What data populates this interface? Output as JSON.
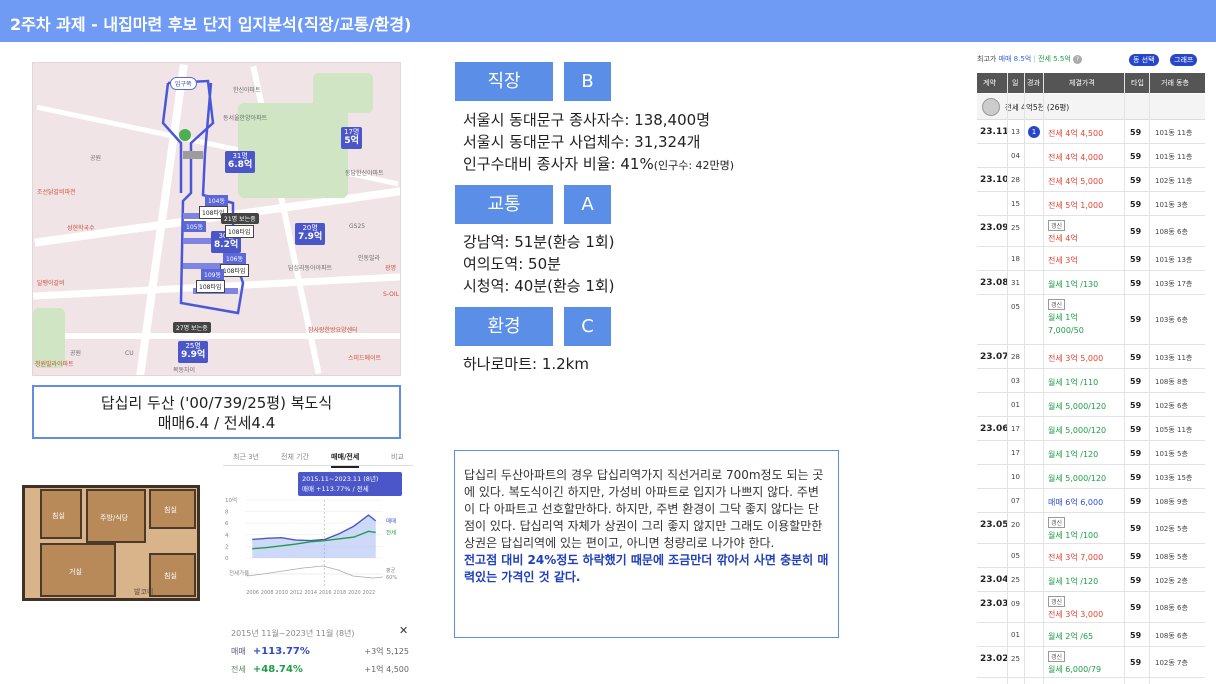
{
  "header": {
    "title": "2주차 과제 - 내집마련 후보 단지 입지분석(직장/교통/환경)"
  },
  "map": {
    "entry_label": "입구쪽",
    "labels": [
      "동서울한양아파트",
      "공원",
      "동답한신아파트",
      "조선닭갈비파전",
      "성현학국수",
      "달팽이갈비",
      "답십리동아아파트",
      "인동빌라",
      "한신아파트",
      "GS25",
      "광명",
      "S-OIL",
      "참사랑한방요양센터",
      "스피드메이트",
      "청원빌라아파트",
      "CU",
      "공원",
      "목동자이"
    ],
    "bubbles": [
      {
        "count": "31명",
        "price": "6.8억"
      },
      {
        "count": "17명",
        "price": "5억"
      },
      {
        "count": "20명",
        "price": "7.9억"
      },
      {
        "count": "30명",
        "price": "8.2억"
      },
      {
        "count": "25명",
        "price": "9.9억"
      }
    ],
    "dong_tags": [
      "104동",
      "108타입",
      "21명 보는중",
      "105동",
      "108타입",
      "106동",
      "108타입",
      "109동",
      "108타입"
    ],
    "watch_label": "27명 보는중"
  },
  "complex": {
    "name": "답십리 두산 ('00/739/25평) 복도식",
    "price": "매매6.4 / 전세4.4"
  },
  "plan": {
    "rooms": [
      "주방/식당",
      "침실",
      "침실",
      "거실",
      "침실",
      "발코니"
    ]
  },
  "pricechart": {
    "tabs": [
      "최근 3년",
      "전체 기간",
      "매매/전세",
      "비교"
    ],
    "tooltip_period": "2015.11~2023.11 (8년)",
    "tooltip_values": "매매 +113.77% / 전세 +48.74%",
    "y_ticks": [
      "10억",
      "8",
      "6",
      "4",
      "2",
      "0"
    ],
    "x_ticks": [
      "2006",
      "2008",
      "2010",
      "2012",
      "2014",
      "2016",
      "2018",
      "2020",
      "2022"
    ],
    "series_labels": [
      "매매",
      "전세"
    ],
    "bottom_label": "전세가율",
    "bottom_right_label": "평균",
    "bottom_right_value": "60%",
    "period_label": "2015년 11월~2023년 11월 (8년)",
    "close_icon": "close-icon",
    "rows": [
      {
        "label": "매매",
        "rate": "+113.77%",
        "diff": "+3억 5,125"
      },
      {
        "label": "전세",
        "rate": "+48.74%",
        "diff": "+1억 4,500"
      }
    ],
    "chart_data": {
      "type": "line",
      "x": [
        2006,
        2008,
        2010,
        2012,
        2014,
        2016,
        2018,
        2020,
        2022,
        2023
      ],
      "series": [
        {
          "name": "매매",
          "values": [
            3.2,
            3.4,
            3.5,
            3.1,
            3.0,
            3.2,
            4.2,
            5.5,
            7.4,
            6.4
          ]
        },
        {
          "name": "전세",
          "values": [
            1.6,
            1.8,
            2.1,
            2.4,
            2.8,
            3.0,
            3.3,
            3.6,
            4.6,
            4.4
          ]
        }
      ],
      "ylim": [
        0,
        10
      ]
    }
  },
  "sections": [
    {
      "category": "직장",
      "grade": "B",
      "lines": [
        "서울시 동대문구 종사자수: 138,400명",
        "서울시 동대문구 사업체수: 31,324개",
        "인구수대비 종사자 비율: 41%"
      ],
      "note": "(인구수: 42만명)"
    },
    {
      "category": "교통",
      "grade": "A",
      "lines": [
        "강남역: 51분(환승 1회)",
        "여의도역: 50분",
        "시청역: 40분(환승 1회)"
      ]
    },
    {
      "category": "환경",
      "grade": "C",
      "lines": [
        "하나로마트: 1.2km"
      ]
    }
  ],
  "comment": {
    "normal": "답십리 두산아파트의 경우 답십리역가지 직선거리로 700m정도 되는 곳에 있다. 복도식이긴 하지만, 가성비 아파트로 입지가 나쁘지 않다. 주변이 다 아파트고 선호할만하다. 하지만, 주변 환경이 그닥 좋지 않다는 단점이 있다. 답십리역 자체가 상권이 그리 좋지 않지만 그래도 이용할만한 상권은 답십리역에 있는 편이고, 아니면 청량리로 나가야 한다.",
    "emphasis": "전고점 대비 24%정도 하락했기 때문에 조금만더 깎아서 사면 충분히 매력있는 가격인 것 같다."
  },
  "transactions": {
    "top_label": "최고가",
    "top_sale": "매매 8.5억",
    "top_sep": "|",
    "top_rent": "전세 5.5억",
    "top_help": "?",
    "btn_dong": "동 선택",
    "btn_graph": "그래프",
    "headers": [
      "계약",
      "일",
      "경과",
      "체결가격",
      "타입",
      "거래 동층"
    ],
    "summary": "전세 4억5천 (26평)",
    "rows": [
      {
        "month": "23.11",
        "day": "13",
        "badge": "1",
        "price": "전세 4억 4,500",
        "kind": "red",
        "area": "59",
        "floor": "101동 11층"
      },
      {
        "month": "",
        "day": "04",
        "price": "전세 4억 4,000",
        "kind": "red",
        "area": "59",
        "floor": "101동 11층"
      },
      {
        "month": "23.10",
        "day": "28",
        "price": "전세 4억 5,000",
        "kind": "red",
        "area": "59",
        "floor": "102동 11층"
      },
      {
        "month": "",
        "day": "15",
        "price": "전세 5억 1,000",
        "kind": "red",
        "area": "59",
        "floor": "101동 3층"
      },
      {
        "month": "23.09",
        "day": "25",
        "renew": "갱신",
        "price": "전세 4억",
        "kind": "red",
        "area": "59",
        "floor": "108동 6층",
        "tall": true
      },
      {
        "month": "",
        "day": "18",
        "price": "전세 3억",
        "kind": "red",
        "area": "59",
        "floor": "101동 13층"
      },
      {
        "month": "23.08",
        "day": "31",
        "price": "월세 1억 /130",
        "kind": "grn",
        "area": "59",
        "floor": "103동 17층"
      },
      {
        "month": "",
        "day": "05",
        "renew": "갱신",
        "price": "월세 1억",
        "price2": "7,000/50",
        "kind": "grn",
        "area": "59",
        "floor": "103동 6층",
        "xtall": true
      },
      {
        "month": "23.07",
        "day": "28",
        "price": "전세 3억 5,000",
        "kind": "red",
        "area": "59",
        "floor": "103동 11층"
      },
      {
        "month": "",
        "day": "03",
        "price": "월세 1억 /110",
        "kind": "grn",
        "area": "59",
        "floor": "108동 8층"
      },
      {
        "month": "",
        "day": "01",
        "price": "월세 5,000/120",
        "kind": "grn",
        "area": "59",
        "floor": "102동 6층"
      },
      {
        "month": "23.06",
        "day": "17",
        "price": "월세 5,000/120",
        "kind": "grn",
        "area": "59",
        "floor": "105동 11층"
      },
      {
        "month": "",
        "day": "17",
        "price": "월세 1억 /120",
        "kind": "grn",
        "area": "59",
        "floor": "101동 5층"
      },
      {
        "month": "",
        "day": "10",
        "price": "월세 5,000/120",
        "kind": "grn",
        "area": "59",
        "floor": "103동 15층"
      },
      {
        "month": "",
        "day": "07",
        "price": "매매 6억 6,000",
        "kind": "blu",
        "area": "59",
        "floor": "108동 9층"
      },
      {
        "month": "23.05",
        "day": "20",
        "renew": "갱신",
        "price": "월세 1억 /100",
        "kind": "grn",
        "area": "59",
        "floor": "102동 5층",
        "tall": true
      },
      {
        "month": "",
        "day": "05",
        "price": "전세 3억 7,000",
        "kind": "red",
        "area": "59",
        "floor": "108동 5층"
      },
      {
        "month": "23.04",
        "day": "25",
        "price": "월세 1억 /120",
        "kind": "grn",
        "area": "59",
        "floor": "102동 2층"
      },
      {
        "month": "23.03",
        "day": "09",
        "renew": "갱신",
        "price": "전세 3억 3,000",
        "kind": "red",
        "area": "59",
        "floor": "108동 6층",
        "tall": true
      },
      {
        "month": "",
        "day": "01",
        "price": "월세 2억 /65",
        "kind": "grn",
        "area": "59",
        "floor": "108동 6층"
      },
      {
        "month": "23.02",
        "day": "25",
        "renew": "갱신",
        "price": "월세 6,000/79",
        "kind": "grn",
        "area": "59",
        "floor": "102동 7층",
        "tall": true
      }
    ]
  }
}
